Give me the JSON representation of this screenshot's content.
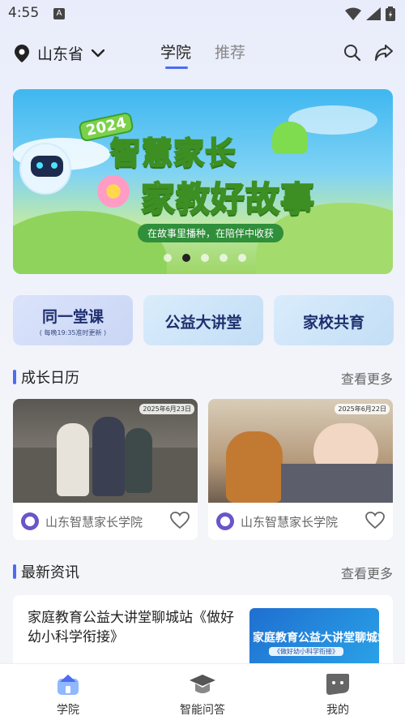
{
  "status_bar": {
    "time": "4:55",
    "notification_icon": "A"
  },
  "header": {
    "location": "山东省",
    "tabs": [
      {
        "label": "学院",
        "active": true
      },
      {
        "label": "推荐",
        "active": false
      }
    ]
  },
  "banner": {
    "year": "2024",
    "title_line1": "智慧家长",
    "title_line2": "家教好故事",
    "subtitle": "在故事里播种，在陪伴中收获",
    "slide_count": 5,
    "active_slide": 2
  },
  "categories": [
    {
      "title": "同一堂课",
      "subtitle": "( 每晚19:35准时更新 )"
    },
    {
      "title": "公益大讲堂",
      "subtitle": ""
    },
    {
      "title": "家校共育",
      "subtitle": ""
    }
  ],
  "growth": {
    "title": "成长日历",
    "more": "查看更多",
    "cards": [
      {
        "date": "2025年6月23日",
        "source": "山东智慧家长学院"
      },
      {
        "date": "2025年6月22日",
        "source": "山东智慧家长学院"
      }
    ]
  },
  "news": {
    "title": "最新资讯",
    "more": "查看更多",
    "items": [
      {
        "title": "家庭教育公益大讲堂聊城站《做好幼小科学衔接》",
        "thumb_title": "家庭教育公益大讲堂聊城站",
        "thumb_sub": "《做好幼小科学衔接》"
      }
    ]
  },
  "bottom_nav": [
    {
      "label": "学院",
      "icon": "academy-icon",
      "active": true
    },
    {
      "label": "智能问答",
      "icon": "graduation-cap-icon",
      "active": false
    },
    {
      "label": "我的",
      "icon": "chat-bubble-icon",
      "active": false
    }
  ],
  "colors": {
    "accent": "#4d6cf0",
    "text": "#222222",
    "muted": "#666666"
  }
}
